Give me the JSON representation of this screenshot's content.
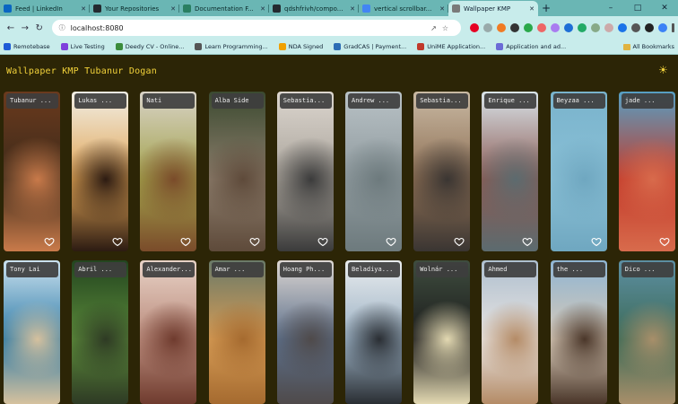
{
  "browser": {
    "tabs": [
      {
        "title": "Feed | LinkedIn",
        "color": "#0a66c2"
      },
      {
        "title": "Your Repositories",
        "color": "#24292f"
      },
      {
        "title": "Documentation F...",
        "color": "#2a7f62"
      },
      {
        "title": "qdshfrivh/compo...",
        "color": "#24292f"
      },
      {
        "title": "vertical scrollbar...",
        "color": "#4285f4"
      },
      {
        "title": "Wallpaper KMP",
        "color": "#7a7a7a",
        "active": true
      }
    ],
    "url": "localhost:8080",
    "bookmarks": [
      {
        "label": "Remotebase",
        "color": "#1e5bd6"
      },
      {
        "label": "Live Testing",
        "color": "#7e3fdc"
      },
      {
        "label": "Deedy CV - Online...",
        "color": "#3b8c3b"
      },
      {
        "label": "Learn Programming...",
        "color": "#555"
      },
      {
        "label": "NDA Signed",
        "color": "#f0a000"
      },
      {
        "label": "GradCAS | Payment...",
        "color": "#2c6db5"
      },
      {
        "label": "UniME Application...",
        "color": "#c0392b"
      },
      {
        "label": "Application and ad...",
        "color": "#6b6bd6"
      }
    ],
    "all_bookmarks_label": "All Bookmarks"
  },
  "app": {
    "title": "Wallpaper KMP Tubanur Dogan",
    "accent": "#f2d23a",
    "background": "#2c2506"
  },
  "row1": [
    {
      "author": "Tubanur ...",
      "colors": [
        "#6b3a1d",
        "#3c2a1a",
        "#c97a4a"
      ]
    },
    {
      "author": "Lukas ...",
      "colors": [
        "#f1efe6",
        "#e0a455",
        "#2c1b12"
      ]
    },
    {
      "author": "Nati",
      "colors": [
        "#d9d3c8",
        "#a2a24b",
        "#7a4b2a"
      ]
    },
    {
      "author": "Alba  Side",
      "colors": [
        "#3b4a30",
        "#8c7d6c",
        "#5e4a3a"
      ]
    },
    {
      "author": "Sebastia...",
      "colors": [
        "#dcd6cf",
        "#a9a39a",
        "#3b3b3b"
      ]
    },
    {
      "author": "Andrew ...",
      "colors": [
        "#b9c2c6",
        "#8f9a9e",
        "#6d7a7d"
      ]
    },
    {
      "author": "Sebastia...",
      "colors": [
        "#c9b9a3",
        "#8d6f54",
        "#3a3532"
      ]
    },
    {
      "author": "Enrique ...",
      "colors": [
        "#d9e4ea",
        "#8b5a52",
        "#5c6b6f"
      ]
    },
    {
      "author": "Beyzaa ...",
      "colors": [
        "#79b3cc",
        "#8ac0d6",
        "#6fa7c0"
      ]
    },
    {
      "author": "jade ...",
      "colors": [
        "#56a0c4",
        "#c23a2a",
        "#d86b4c"
      ]
    }
  ],
  "row2": [
    {
      "author": "Tony Lai",
      "colors": [
        "#cbe1ef",
        "#2c7aa6",
        "#d6c19e"
      ]
    },
    {
      "author": "Abril ...",
      "colors": [
        "#23451f",
        "#5b8a3a",
        "#2e3a24"
      ]
    },
    {
      "author": "Alexander...",
      "colors": [
        "#e8d2c6",
        "#b98a7b",
        "#6f3b2e"
      ]
    },
    {
      "author": "Amar ...",
      "colors": [
        "#6a7a68",
        "#d59b55",
        "#a56a2f"
      ]
    },
    {
      "author": "Hoang Ph...",
      "colors": [
        "#ddd7d3",
        "#5c6f8a",
        "#4f4a4a"
      ]
    },
    {
      "author": "Beladiya...",
      "colors": [
        "#e9ecee",
        "#9bb1c4",
        "#2a2e33"
      ]
    },
    {
      "author": "Wolnár ...",
      "colors": [
        "#3f4d3f",
        "#1b1b1b",
        "#e3d9b2"
      ]
    },
    {
      "author": "Ahmed  ",
      "colors": [
        "#aebfcf",
        "#e8e4e1",
        "#b48b66"
      ]
    },
    {
      "author": "the ...",
      "colors": [
        "#8fb5d3",
        "#d7c9b7",
        "#4a3629"
      ]
    },
    {
      "author": "Dico ...",
      "colors": [
        "#5d8fa3",
        "#3c6a56",
        "#a88f6a"
      ]
    }
  ]
}
